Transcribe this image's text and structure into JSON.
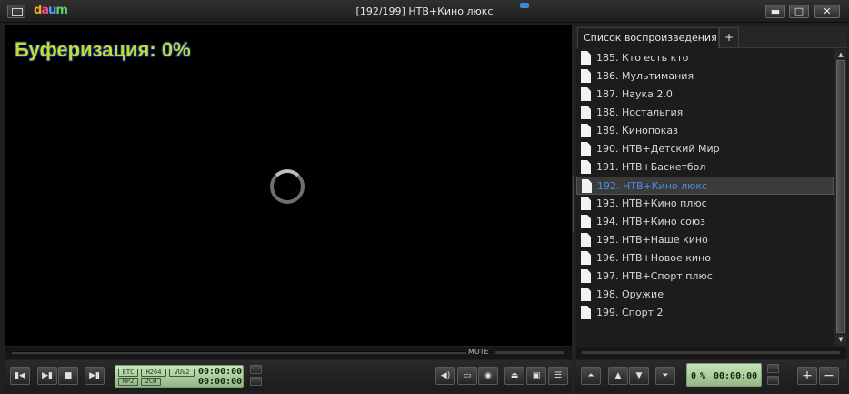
{
  "window": {
    "title": "[192/199] НТВ+Кино люкс",
    "logo": [
      "d",
      "a",
      "u",
      "m"
    ]
  },
  "title_buttons": {
    "minimize": "▬",
    "maximize": "□",
    "close": "✕"
  },
  "video": {
    "buffering_text": "Буферизация: 0%"
  },
  "seek": {
    "mute_label": "MUTE"
  },
  "controls": {
    "prev": "▮◀",
    "play_pause": "▶▮",
    "stop": "■",
    "next": "▶▮",
    "tags_row1": [
      "ETC",
      "H264",
      "VUV2"
    ],
    "tags_row2": [
      "MP2",
      "2CH"
    ],
    "time_elapsed": "00:00:00",
    "time_total": "00:00:00",
    "right_buttons": [
      "◀)",
      "▭",
      "◉",
      "⏏",
      "▣",
      "☰"
    ]
  },
  "playlist": {
    "tab_label": "Список воспроизведения",
    "add_tab": "+",
    "items": [
      {
        "label": "185. Кто есть кто"
      },
      {
        "label": "186. Мультимания"
      },
      {
        "label": "187. Наука 2.0"
      },
      {
        "label": "188. Ностальгия"
      },
      {
        "label": "189. Кинопоказ"
      },
      {
        "label": "190. НТВ+Детский Мир"
      },
      {
        "label": "191. НТВ+Баскетбол"
      },
      {
        "label": "192. НТВ+Кино люкс",
        "selected": true
      },
      {
        "label": "193. НТВ+Кино плюс"
      },
      {
        "label": "194. НТВ+Кино союз"
      },
      {
        "label": "195. НТВ+Наше кино"
      },
      {
        "label": "196. НТВ+Новое кино"
      },
      {
        "label": "197. НТВ+Спорт плюс"
      },
      {
        "label": "198. Оружие"
      },
      {
        "label": "199. Спорт 2"
      }
    ],
    "selected_index": 7
  },
  "playlist_controls": {
    "move_top": "⏶",
    "move_up": "▲",
    "move_down": "▼",
    "move_bottom": "⏷",
    "lcd_percent": "0",
    "lcd_percent_sign": "%",
    "lcd_time": "00:00:00",
    "add": "+",
    "remove": "−"
  },
  "colors": {
    "buffer_text": "#c8d832",
    "selected_item_text": "#4a8fe0",
    "lcd_green": "#b5d6a6"
  }
}
